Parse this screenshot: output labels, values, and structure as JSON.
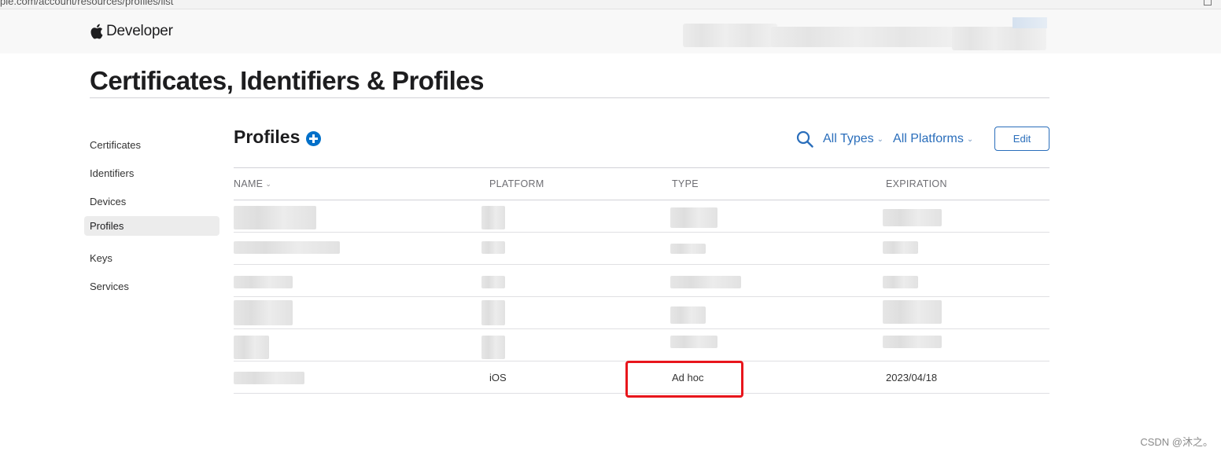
{
  "browser": {
    "url_fragment": "ple.com/account/resources/profiles/list"
  },
  "header": {
    "brand_label": "Developer",
    "apple_icon": "apple-logo-icon"
  },
  "page": {
    "title": "Certificates, Identifiers & Profiles"
  },
  "sidebar": {
    "items": [
      {
        "label": "Certificates",
        "active": false
      },
      {
        "label": "Identifiers",
        "active": false
      },
      {
        "label": "Devices",
        "active": false
      },
      {
        "label": "Profiles",
        "active": true
      },
      {
        "label": "Keys",
        "active": false
      },
      {
        "label": "Services",
        "active": false
      }
    ]
  },
  "profiles": {
    "title": "Profiles",
    "add_icon": "plus-circle-icon",
    "search_icon": "search-icon",
    "filter_types": "All Types",
    "filter_platforms": "All Platforms",
    "edit_label": "Edit",
    "columns": {
      "name": "NAME",
      "platform": "PLATFORM",
      "type": "TYPE",
      "expiration": "EXPIRATION"
    },
    "visible_row": {
      "platform": "iOS",
      "type": "Ad hoc",
      "expiration": "2023/04/18"
    }
  },
  "colors": {
    "accent": "#2a6ebb",
    "add_button": "#0070c9",
    "highlight_box": "#e8161c"
  },
  "watermark": "CSDN @沐之。"
}
